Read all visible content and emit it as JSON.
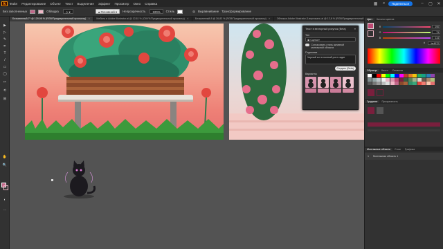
{
  "app": {
    "logo": "Ai"
  },
  "menu": {
    "items": [
      "Файл",
      "Редактирование",
      "Объект",
      "Текст",
      "Выделение",
      "Эффект",
      "Просмотр",
      "Окно",
      "Справка"
    ],
    "share_label": "Поделиться"
  },
  "controlbar": {
    "left_label": "Без заполненных",
    "stroke_label": "Обводка",
    "opacity_label": "Непрозрачность",
    "opacity_value": "100%",
    "style_label": "Стиль",
    "transform_label": "Трансформирование",
    "align_label": "Выравнивание",
    "colors": {
      "fill": "#c2688a",
      "stroke": "#f0b7c6"
    }
  },
  "tabs": [
    {
      "label": "Безымянный-7* @ 129,96 % (RGB/Предварительный просмотр)",
      "active": true
    },
    {
      "label": "Мебель в Adobe Illustrator.ai @ 12,81 % (CMYK/Предварительный просмотр)",
      "active": false
    },
    {
      "label": "Безымянный-8 @ 26,83 % (RGB/Предварительный просмотр)",
      "active": false
    },
    {
      "label": "Обложка Adobe Illustrator-3-вертикаль.ai @ 12,8 % (RGB/Предварительный просмотр)",
      "active": false
    }
  ],
  "tools": [
    "▶",
    "▷",
    "✎",
    "✒",
    "T",
    "/",
    "▭",
    "◯",
    "✂",
    "⟲",
    "⊞",
    "✋",
    "🔍",
    "◐"
  ],
  "text_to_vector_panel": {
    "title": "Текст в векторный рисунок (Beta)",
    "type_label": "Тип",
    "type_value": "Сцена",
    "match_style_label": "Согласовать стиль активной монтажной области",
    "prompt_label": "Подсказка",
    "prompt_value": "Черный кот в полный рост сидит",
    "generate_label": "Создать (Beta)",
    "variations_label": "Варианты"
  },
  "right_dock": {
    "tabs": [
      "Цвет",
      "Каталог цветов"
    ],
    "sliders": [
      {
        "label": "R",
        "value": "190"
      },
      {
        "label": "G",
        "value": "73"
      },
      {
        "label": "B",
        "value": "114"
      }
    ],
    "hex_value": "be4972",
    "swatches_tabs": [
      "Образцы",
      "Кисти",
      "Символы"
    ],
    "gradient_tabs": [
      "Градиент",
      "Прозрачность"
    ],
    "artboards_tabs": [
      "Монтажные области",
      "Слои",
      "Графика"
    ],
    "artboard_rows": [
      {
        "num": "1",
        "name": "Монтажная область 1"
      }
    ],
    "colors": {
      "selected_fill": "#be4972",
      "gradient_bar": "#7a1f3d"
    }
  },
  "canvas": {
    "background": "#535353"
  }
}
